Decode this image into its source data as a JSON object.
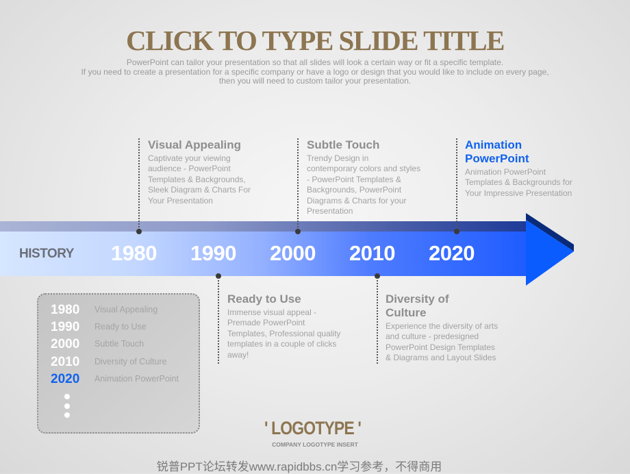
{
  "header": {
    "title": "CLICK TO TYPE SLIDE TITLE",
    "subtitle_lines": [
      "PowerPoint can tailor your presentation so that all slides will look a certain way or fit a specific template.",
      "If you need to create a presentation for a specific company or have a logo or design that you would like to include on every page,",
      "then you will need to custom tailor your presentation."
    ]
  },
  "timeline": {
    "label": "HISTORY",
    "years": [
      "1980",
      "1990",
      "2000",
      "2010",
      "2020"
    ],
    "colors": {
      "band_dark": "#1e3a98",
      "band_bright": "#1f5cff",
      "arrow_shadow": "#0a2a7a",
      "accent_blue": "#1162ee"
    }
  },
  "callouts": [
    {
      "year": "1980",
      "title": "Visual Appealing",
      "body": [
        "Captivate your viewing",
        "audience - PowerPoint",
        "Templates & Backgrounds,",
        "Sleek Diagram & Charts For",
        "Your Presentation"
      ]
    },
    {
      "year": "1990",
      "title": "Ready to Use",
      "body": [
        "Immense visual appeal -",
        "Premade PowerPoint",
        "Templates, Professional quality",
        "templates in a couple of clicks",
        "away!"
      ]
    },
    {
      "year": "2000",
      "title": "Subtle Touch",
      "body": [
        "Trendy Design in",
        "contemporary colors and styles",
        "- PowerPoint Templates &",
        "Backgrounds, PowerPoint",
        "Diagrams & Charts for your",
        "Presentation"
      ]
    },
    {
      "year": "2010",
      "title_lines": [
        "Diversity of",
        "Culture"
      ],
      "body": [
        "Experience the diversity of arts",
        "and culture - predesigned",
        "PowerPoint Design Templates",
        "& Diagrams and Layout Slides"
      ]
    },
    {
      "year": "2020",
      "title_lines": [
        "Animation",
        "PowerPoint"
      ],
      "body": [
        "Animation PowerPoint",
        "Templates & Backgrounds for",
        "Your Impressive  Presentation"
      ]
    }
  ],
  "summary": {
    "items": [
      {
        "year": "1980",
        "label": "Visual Appealing"
      },
      {
        "year": "1990",
        "label": "Ready to Use"
      },
      {
        "year": "2000",
        "label": "Subtle Touch"
      },
      {
        "year": "2010",
        "label": "Diversity of Culture"
      },
      {
        "year": "2020",
        "label": "Animation PowerPoint",
        "highlight": true
      }
    ]
  },
  "logo": {
    "text": "' LOGOTYPE '",
    "subtext": "COMPANY LOGOTYPE INSERT"
  },
  "footer": {
    "text": "锐普PPT论坛转发www.rapidbbs.cn学习参考，不得商用"
  }
}
